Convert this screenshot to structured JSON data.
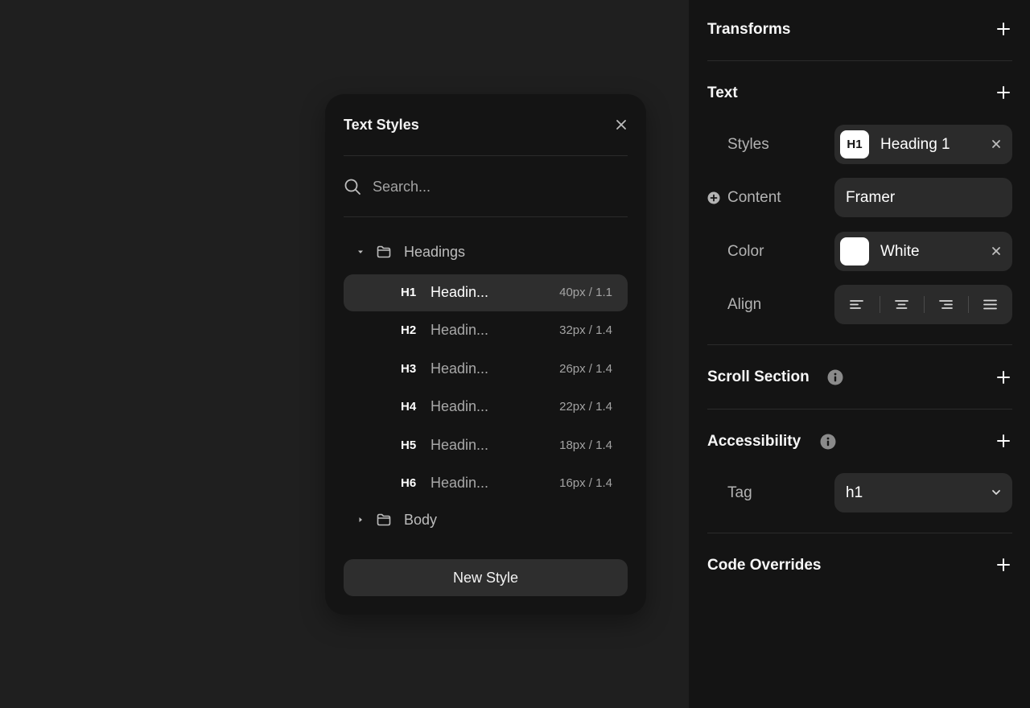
{
  "popup": {
    "title": "Text Styles",
    "search_placeholder": "Search...",
    "folders": {
      "headings": "Headings",
      "body": "Body"
    },
    "styles": [
      {
        "tag": "H1",
        "name": "Headin...",
        "meta": "40px / 1.1",
        "active": true
      },
      {
        "tag": "H2",
        "name": "Headin...",
        "meta": "32px / 1.4",
        "active": false
      },
      {
        "tag": "H3",
        "name": "Headin...",
        "meta": "26px / 1.4",
        "active": false
      },
      {
        "tag": "H4",
        "name": "Headin...",
        "meta": "22px / 1.4",
        "active": false
      },
      {
        "tag": "H5",
        "name": "Headin...",
        "meta": "18px / 1.4",
        "active": false
      },
      {
        "tag": "H6",
        "name": "Headin...",
        "meta": "16px / 1.4",
        "active": false
      }
    ],
    "new_style_label": "New Style"
  },
  "panel": {
    "transforms_title": "Transforms",
    "text": {
      "title": "Text",
      "styles_label": "Styles",
      "styles_badge": "H1",
      "styles_value": "Heading 1",
      "content_label": "Content",
      "content_value": "Framer",
      "color_label": "Color",
      "color_value": "White",
      "color_swatch": "#ffffff",
      "align_label": "Align"
    },
    "scroll_section_title": "Scroll Section",
    "accessibility": {
      "title": "Accessibility",
      "tag_label": "Tag",
      "tag_value": "h1"
    },
    "code_overrides_title": "Code Overrides"
  },
  "colors": {
    "canvas": "#1f1f1f",
    "panel": "#141414",
    "field": "#2b2b2b",
    "active_row": "#2e2e2e"
  },
  "icons": {
    "close": "close-icon",
    "search": "search-icon",
    "folder": "folder-icon",
    "caret_down": "caret-down-icon",
    "caret_right": "caret-right-icon",
    "plus": "plus-icon",
    "info": "info-icon",
    "add_circle": "add-circle-icon",
    "chevron_down": "chevron-down-icon",
    "align_left": "align-left-icon",
    "align_center": "align-center-icon",
    "align_right": "align-right-icon",
    "align_justify": "align-justify-icon"
  }
}
